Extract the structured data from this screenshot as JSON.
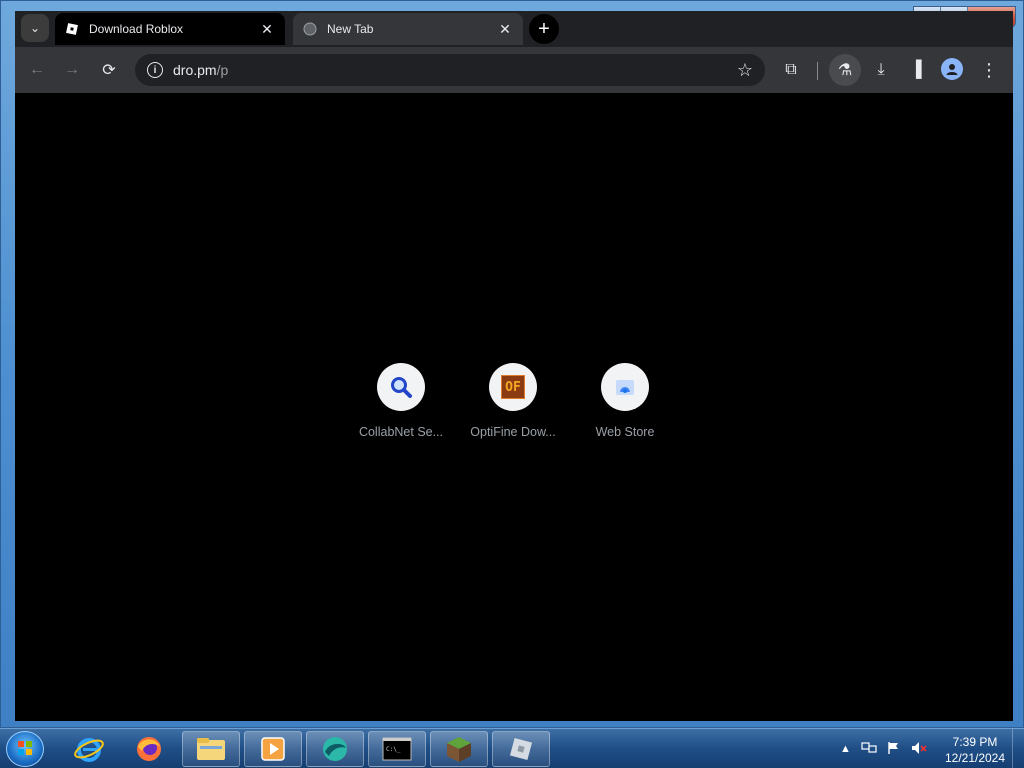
{
  "window": {
    "minimize_label": "—",
    "maximize_label": "☐",
    "close_label": "✕"
  },
  "tabs": [
    {
      "title": "Download Roblox",
      "close": "✕"
    },
    {
      "title": "New Tab",
      "close": "✕"
    }
  ],
  "tabstrip": {
    "tab_search_label": "⌄",
    "new_tab_label": "+"
  },
  "toolbar": {
    "back_label": "←",
    "forward_label": "→",
    "reload_label": "⟳",
    "info_label": "i",
    "url_host": "dro.pm",
    "url_path": "/p",
    "bookmark_label": "☆",
    "extensions_label": "⧉",
    "labs_label": "⚗",
    "downloads_label": "⤓",
    "sidepanel_label": "▐",
    "menu_label": "⋮"
  },
  "shortcuts": [
    {
      "label": "CollabNet Se...",
      "icon": "magnifier-icon"
    },
    {
      "label": "OptiFine Dow...",
      "icon": "optifine-icon",
      "glyph": "OF"
    },
    {
      "label": "Web Store",
      "icon": "webstore-icon"
    }
  ],
  "taskbar": {
    "apps": [
      "internet-explorer",
      "firefox",
      "file-explorer",
      "media-player",
      "browser-app",
      "command-prompt",
      "minecraft",
      "roblox"
    ],
    "tray_arrow": "▲",
    "cmd_glyph": "C:\\_"
  },
  "clock": {
    "time": "7:39 PM",
    "date": "12/21/2024"
  }
}
